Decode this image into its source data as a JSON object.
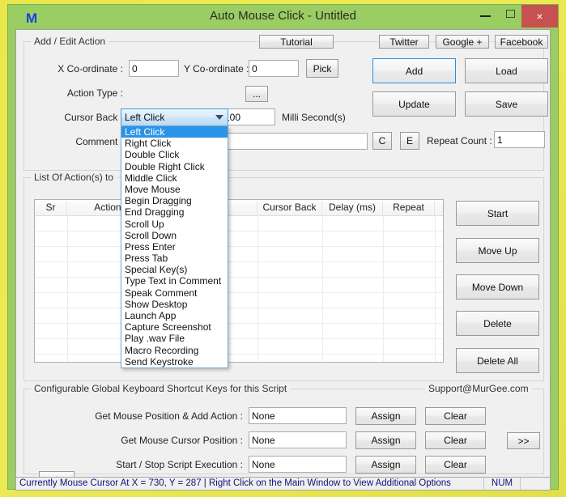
{
  "window": {
    "logo": "M",
    "title": "Auto Mouse Click - Untitled",
    "minimize": "minimize-icon",
    "maximize": "maximize-icon",
    "close": "×"
  },
  "add_edit_group": {
    "title": "Add / Edit Action",
    "tutorial_label": "Tutorial",
    "social": [
      {
        "label": "Twitter"
      },
      {
        "label": "Google +"
      },
      {
        "label": "Facebook"
      }
    ],
    "fields": {
      "x_label": "X Co-ordinate :",
      "x_value": "0",
      "y_label": "Y Co-ordinate :",
      "y_value": "0",
      "pick_label": "Pick",
      "action_type_label": "Action Type :",
      "action_type_value": "Left Click",
      "browse_label": "...",
      "cursor_back_label": "Cursor Back :",
      "delay_value": "100",
      "milli_label": "Milli Second(s)",
      "comment_label": "Comment :",
      "comment_value": "",
      "c_label": "C",
      "e_label": "E",
      "repeat_count_label": "Repeat Count :",
      "repeat_count_value": "1"
    },
    "buttons": {
      "add": "Add",
      "load": "Load",
      "update": "Update",
      "save": "Save"
    },
    "dropdown_options": [
      "Left Click",
      "Right Click",
      "Double Click",
      "Double Right Click",
      "Middle Click",
      "Move Mouse",
      "Begin Dragging",
      "End Dragging",
      "Scroll Up",
      "Scroll Down",
      "Press Enter",
      "Press Tab",
      "Special Key(s)",
      "Type Text in Comment",
      "Speak Comment",
      "Show Desktop",
      "Launch App",
      "Capture Screenshot",
      "Play .wav File",
      "Macro Recording",
      "Send Keystroke"
    ],
    "dropdown_selected": "Left Click"
  },
  "list_group": {
    "title": "List Of Action(s) to ",
    "columns": [
      "Sr",
      "Action Type",
      "",
      "Cursor Back",
      "Delay (ms)",
      "Repeat"
    ],
    "rows": [],
    "buttons": {
      "start": "Start",
      "move_up": "Move Up",
      "move_down": "Move Down",
      "delete": "Delete",
      "delete_all": "Delete All"
    }
  },
  "shortcut_group": {
    "title": "Configurable Global Keyboard Shortcut Keys for this Script",
    "support": "Support@MurGee.com",
    "rows": [
      {
        "label": "Get Mouse Position & Add Action :",
        "value": "None",
        "assign": "Assign",
        "clear": "Clear"
      },
      {
        "label": "Get Mouse Cursor Position :",
        "value": "None",
        "assign": "Assign",
        "clear": "Clear"
      },
      {
        "label": "Start / Stop Script Execution :",
        "value": "None",
        "assign": "Assign",
        "clear": "Clear"
      }
    ],
    "expand_label": ">>",
    "collapse_label": "^"
  },
  "statusbar": {
    "text": "Currently Mouse Cursor At X = 730, Y = 287 | Right Click on the Main Window to View Additional Options",
    "num": "NUM"
  },
  "colors": {
    "window_frame": "#9acd62",
    "desktop": "#ecea55",
    "close_button": "#c75050",
    "accent_blue": "#2a94e8",
    "status_text": "#10107a"
  }
}
